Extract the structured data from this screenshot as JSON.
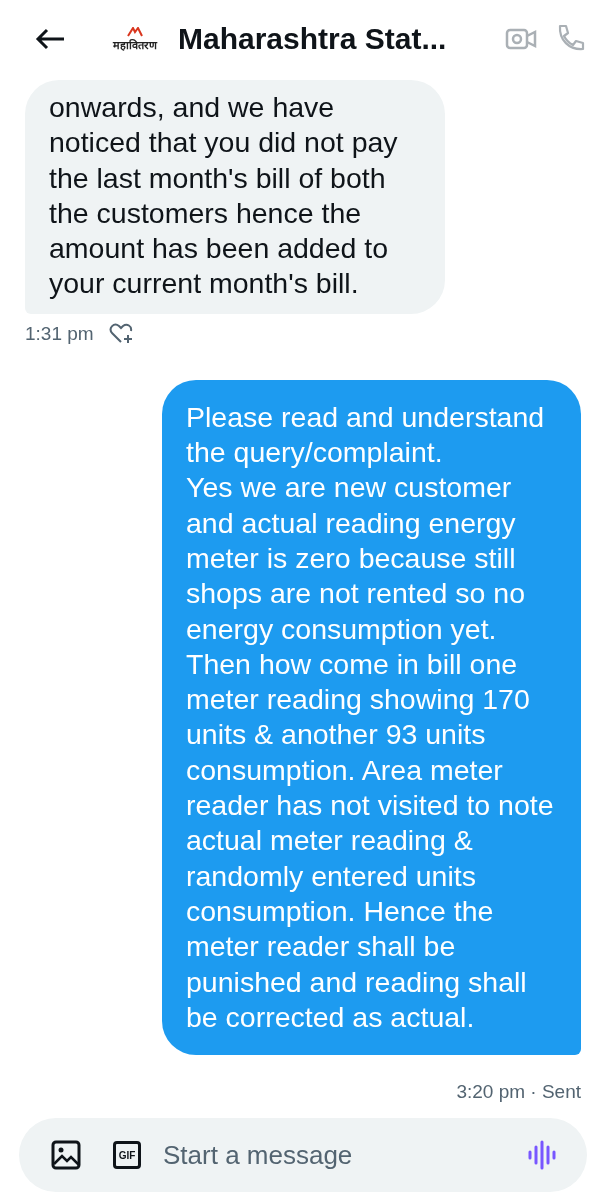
{
  "header": {
    "logo_text": "महावितरण",
    "title": "Maharashtra Stat..."
  },
  "messages": [
    {
      "kind": "received",
      "text": "onwards, and we have noticed that you did not pay the last month's bill of both the customers hence the amount has been added to your current month's bill.",
      "meta": "1:31 pm"
    },
    {
      "kind": "sent",
      "text": "Please read and understand the query/complaint.\nYes we are new customer and actual reading energy meter is zero because still shops are not rented so no energy consumption yet. Then how come in bill one meter reading showing 170 units & another 93 units consumption. Area meter reader has not visited to note actual meter reading & randomly entered units consumption. Hence the meter reader shall be punished and reading shall be corrected as actual.",
      "meta": "3:20 pm · Sent"
    }
  ],
  "composer": {
    "placeholder": "Start a message",
    "gif_label": "GIF"
  }
}
